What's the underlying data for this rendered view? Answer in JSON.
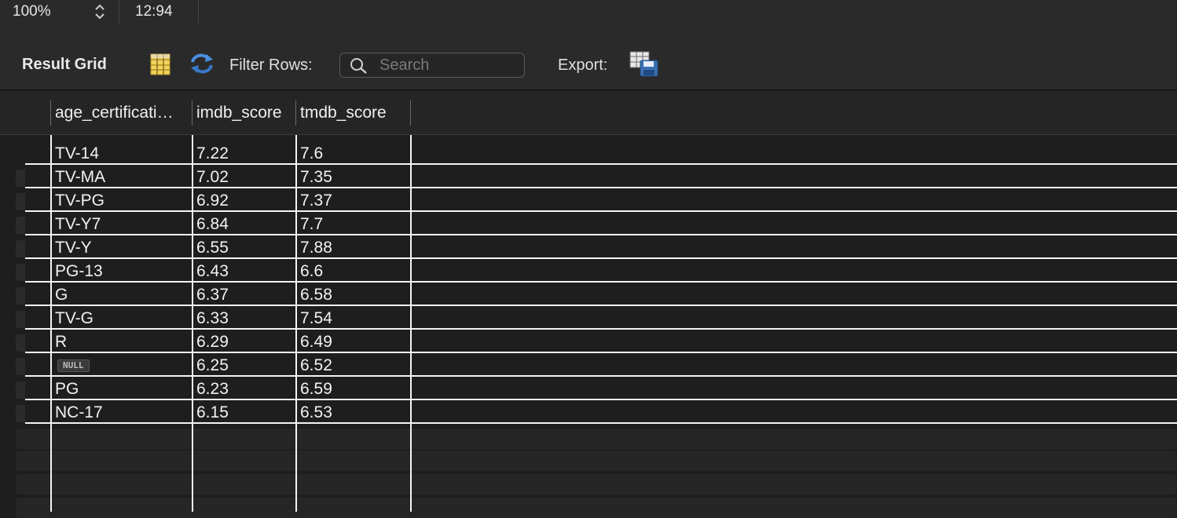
{
  "statusbar": {
    "zoom": "100%",
    "position": "12:94"
  },
  "toolbar": {
    "result_grid_label": "Result Grid",
    "filter_rows_label": "Filter Rows:",
    "search_placeholder": "Search",
    "export_label": "Export:",
    "accent_color": "#4a8fe0"
  },
  "grid": {
    "columns": [
      "age_certificati…",
      "imdb_score",
      "tmdb_score"
    ],
    "rows": [
      [
        "TV-14",
        "7.22",
        "7.6"
      ],
      [
        "TV-MA",
        "7.02",
        "7.35"
      ],
      [
        "TV-PG",
        "6.92",
        "7.37"
      ],
      [
        "TV-Y7",
        "6.84",
        "7.7"
      ],
      [
        "TV-Y",
        "6.55",
        "7.88"
      ],
      [
        "PG-13",
        "6.43",
        "6.6"
      ],
      [
        "G",
        "6.37",
        "6.58"
      ],
      [
        "TV-G",
        "6.33",
        "7.54"
      ],
      [
        "R",
        "6.29",
        "6.49"
      ],
      [
        "NULL",
        "6.25",
        "6.52"
      ],
      [
        "PG",
        "6.23",
        "6.59"
      ],
      [
        "NC-17",
        "6.15",
        "6.53"
      ]
    ]
  }
}
